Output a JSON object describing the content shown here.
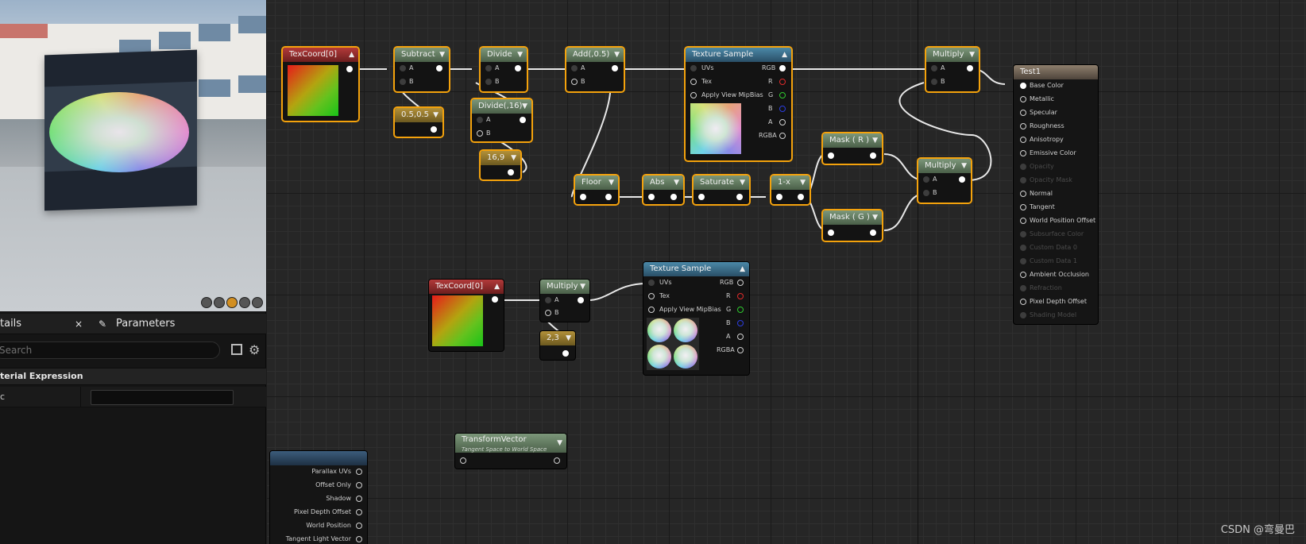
{
  "details": {
    "tab_details": "tails",
    "tab_close": "×",
    "tab_parameters": "Parameters",
    "search_placeholder": "Search",
    "section_title": "terial Expression",
    "prop_label": "c"
  },
  "nodes": {
    "texcoord1": {
      "title": "TexCoord[0]"
    },
    "subtract": {
      "title": "Subtract",
      "pin_a": "A",
      "pin_b": "B"
    },
    "const050": {
      "title": "0.5,0.5"
    },
    "divide": {
      "title": "Divide",
      "pin_a": "A",
      "pin_b": "B"
    },
    "divide16": {
      "title": "Divide(,16)",
      "pin_a": "A",
      "pin_b": "B"
    },
    "const169": {
      "title": "16,9"
    },
    "add05": {
      "title": "Add(,0.5)",
      "pin_a": "A",
      "pin_b": "B"
    },
    "texsample1": {
      "title": "Texture Sample",
      "in": [
        "UVs",
        "Tex",
        "Apply View MipBias"
      ],
      "out": [
        "RGB",
        "R",
        "G",
        "B",
        "A",
        "RGBA"
      ]
    },
    "floor": {
      "title": "Floor"
    },
    "abs": {
      "title": "Abs"
    },
    "saturate": {
      "title": "Saturate"
    },
    "oneminus": {
      "title": "1-x"
    },
    "maskr": {
      "title": "Mask ( R )"
    },
    "maskg": {
      "title": "Mask ( G )"
    },
    "multiply_top": {
      "title": "Multiply",
      "pin_a": "A",
      "pin_b": "B"
    },
    "multiply_mid": {
      "title": "Multiply",
      "pin_a": "A",
      "pin_b": "B"
    },
    "result": {
      "title": "Test1",
      "pins": [
        "Base Color",
        "Metallic",
        "Specular",
        "Roughness",
        "Anisotropy",
        "Emissive Color",
        "Opacity",
        "Opacity Mask",
        "Normal",
        "Tangent",
        "World Position Offset",
        "Subsurface Color",
        "Custom Data 0",
        "Custom Data 1",
        "Ambient Occlusion",
        "Refraction",
        "Pixel Depth Offset",
        "Shading Model"
      ]
    },
    "texcoord2": {
      "title": "TexCoord[0]"
    },
    "multiply_low": {
      "title": "Multiply",
      "pin_a": "A",
      "pin_b": "B"
    },
    "const23": {
      "title": "2,3"
    },
    "texsample2": {
      "title": "Texture Sample",
      "in": [
        "UVs",
        "Tex",
        "Apply View MipBias"
      ],
      "out": [
        "RGB",
        "R",
        "G",
        "B",
        "A",
        "RGBA"
      ]
    },
    "transform": {
      "title": "TransformVector",
      "subtitle": "Tangent Space to World Space"
    },
    "partial": {
      "pins": [
        "Parallax UVs",
        "Offset Only",
        "Shadow",
        "Pixel Depth Offset",
        "World Position",
        "Tangent Light Vector"
      ]
    }
  },
  "watermark": "CSDN @弯曼巴",
  "colors": {
    "accent": "#f4a20c",
    "graph_bg": "#262626"
  }
}
